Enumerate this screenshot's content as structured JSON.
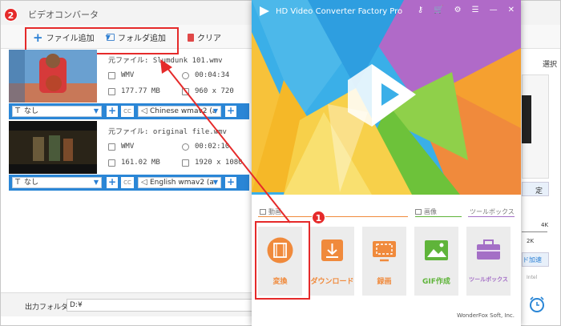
{
  "converter": {
    "title": "ビデオコンバータ",
    "toolbar": {
      "add_file": "ファイル追加",
      "add_folder": "フォルダ追加",
      "clear": "クリア"
    },
    "videos": [
      {
        "filename": "元ファイル: Slumdunk 101.wmv",
        "format": "WMV",
        "duration": "00:04:34",
        "size": "177.77 MB",
        "resolution": "960 x 720",
        "subtitle": "なし",
        "audio": "Chinese wmav2 (a"
      },
      {
        "filename": "元ファイル: original file.wmv",
        "format": "WMV",
        "duration": "00:02:10",
        "size": "161.02 MB",
        "resolution": "1920 x 1080",
        "subtitle": "なし",
        "audio": "English wmav2 (a"
      }
    ],
    "cc_label": "CC",
    "output_label": "出力フォルダ:",
    "output_path": "D:¥",
    "right_strip": {
      "choose": "選択",
      "setting": "定",
      "res_4k": "4K",
      "res_2k": "2K",
      "accel": "ド加速",
      "intel": "Intel"
    }
  },
  "launcher": {
    "title": "HD Video Converter Factory Pro",
    "sections": {
      "video": "動画",
      "image": "画像",
      "toolbox": "ツールボックス"
    },
    "tiles": [
      {
        "label": "変換",
        "icon": "film-icon",
        "color": "#f08a3c"
      },
      {
        "label": "ダウンロード",
        "icon": "download-icon",
        "color": "#f08a3c"
      },
      {
        "label": "録画",
        "icon": "monitor-record-icon",
        "color": "#f08a3c"
      },
      {
        "label": "GIF作成",
        "icon": "image-icon",
        "color": "#5fb43a"
      },
      {
        "label": "ツールボックス",
        "icon": "toolbox-icon",
        "color": "#a46fc6"
      }
    ],
    "footer": "WonderFox Soft, Inc."
  },
  "annotations": {
    "step1": "1",
    "step2": "2",
    "highlight_color": "#e52a2a"
  }
}
